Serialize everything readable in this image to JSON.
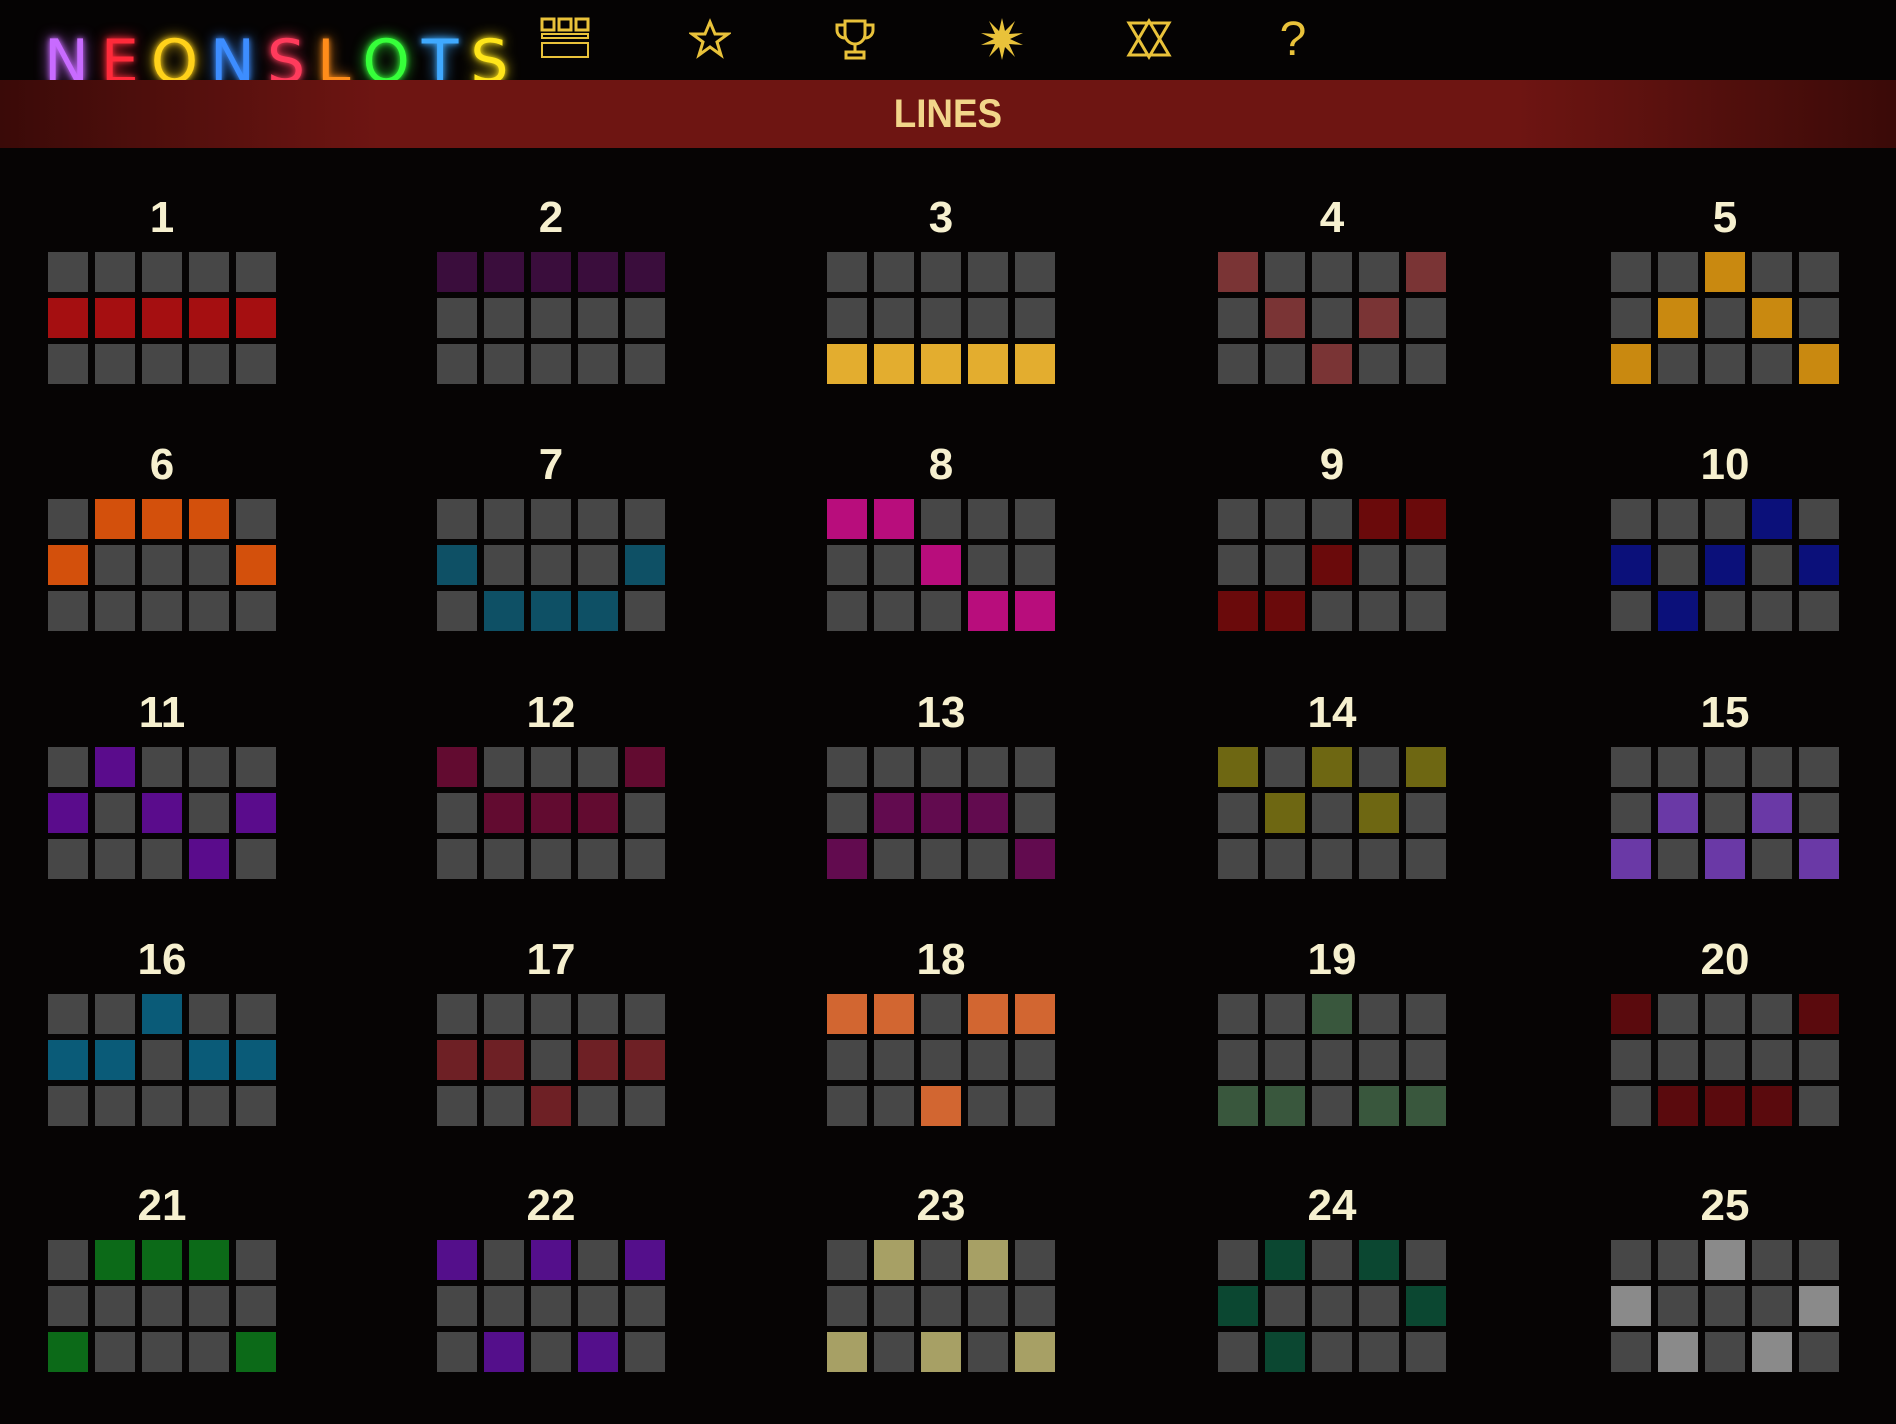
{
  "logo": {
    "letters": [
      {
        "ch": "N",
        "color": "#c86bff"
      },
      {
        "ch": "E",
        "color": "#ff2a3a"
      },
      {
        "ch": "O",
        "color": "#ffd21a"
      },
      {
        "ch": "N",
        "color": "#3d8dff"
      },
      {
        "ch": "S",
        "color": "#ff3b5c"
      },
      {
        "ch": "L",
        "color": "#ff8c1a"
      },
      {
        "ch": "O",
        "color": "#36ff3a"
      },
      {
        "ch": "T",
        "color": "#3fa9ff"
      },
      {
        "ch": "S",
        "color": "#ffe51a"
      }
    ]
  },
  "nav": [
    {
      "name": "paytable-icon"
    },
    {
      "name": "star-icon"
    },
    {
      "name": "trophy-icon"
    },
    {
      "name": "burst-icon"
    },
    {
      "name": "scatter-icon"
    },
    {
      "name": "help-icon",
      "label": "?"
    }
  ],
  "header": {
    "title": "LINES"
  },
  "cell_off_color": "#474747",
  "lines": [
    {
      "n": "1",
      "color": "#a50f11",
      "rows": [
        [
          0,
          0,
          0,
          0,
          0
        ],
        [
          1,
          1,
          1,
          1,
          1
        ],
        [
          0,
          0,
          0,
          0,
          0
        ]
      ]
    },
    {
      "n": "2",
      "color": "#3a0d3c",
      "rows": [
        [
          1,
          1,
          1,
          1,
          1
        ],
        [
          0,
          0,
          0,
          0,
          0
        ],
        [
          0,
          0,
          0,
          0,
          0
        ]
      ]
    },
    {
      "n": "3",
      "color": "#e3ad2f",
      "rows": [
        [
          0,
          0,
          0,
          0,
          0
        ],
        [
          0,
          0,
          0,
          0,
          0
        ],
        [
          1,
          1,
          1,
          1,
          1
        ]
      ]
    },
    {
      "n": "4",
      "color": "#7a3435",
      "rows": [
        [
          1,
          0,
          0,
          0,
          1
        ],
        [
          0,
          1,
          0,
          1,
          0
        ],
        [
          0,
          0,
          1,
          0,
          0
        ]
      ]
    },
    {
      "n": "5",
      "color": "#c98910",
      "rows": [
        [
          0,
          0,
          1,
          0,
          0
        ],
        [
          0,
          1,
          0,
          1,
          0
        ],
        [
          1,
          0,
          0,
          0,
          1
        ]
      ]
    },
    {
      "n": "6",
      "color": "#d3500c",
      "rows": [
        [
          0,
          1,
          1,
          1,
          0
        ],
        [
          1,
          0,
          0,
          0,
          1
        ],
        [
          0,
          0,
          0,
          0,
          0
        ]
      ]
    },
    {
      "n": "7",
      "color": "#0e5065",
      "rows": [
        [
          0,
          0,
          0,
          0,
          0
        ],
        [
          1,
          0,
          0,
          0,
          1
        ],
        [
          0,
          1,
          1,
          1,
          0
        ]
      ]
    },
    {
      "n": "8",
      "color": "#b80d7c",
      "rows": [
        [
          1,
          1,
          0,
          0,
          0
        ],
        [
          0,
          0,
          1,
          0,
          0
        ],
        [
          0,
          0,
          0,
          1,
          1
        ]
      ]
    },
    {
      "n": "9",
      "color": "#6a0a0b",
      "rows": [
        [
          0,
          0,
          0,
          1,
          1
        ],
        [
          0,
          0,
          1,
          0,
          0
        ],
        [
          1,
          1,
          0,
          0,
          0
        ]
      ]
    },
    {
      "n": "10",
      "color": "#0b107a",
      "rows": [
        [
          0,
          0,
          0,
          1,
          0
        ],
        [
          1,
          0,
          1,
          0,
          1
        ],
        [
          0,
          1,
          0,
          0,
          0
        ]
      ]
    },
    {
      "n": "11",
      "color": "#5a0c8c",
      "rows": [
        [
          0,
          1,
          0,
          0,
          0
        ],
        [
          1,
          0,
          1,
          0,
          1
        ],
        [
          0,
          0,
          0,
          1,
          0
        ]
      ]
    },
    {
      "n": "12",
      "color": "#620b30",
      "rows": [
        [
          1,
          0,
          0,
          0,
          1
        ],
        [
          0,
          1,
          1,
          1,
          0
        ],
        [
          0,
          0,
          0,
          0,
          0
        ]
      ]
    },
    {
      "n": "13",
      "color": "#620b4f",
      "rows": [
        [
          0,
          0,
          0,
          0,
          0
        ],
        [
          0,
          1,
          1,
          1,
          0
        ],
        [
          1,
          0,
          0,
          0,
          1
        ]
      ]
    },
    {
      "n": "14",
      "color": "#6e6712",
      "rows": [
        [
          1,
          0,
          1,
          0,
          1
        ],
        [
          0,
          1,
          0,
          1,
          0
        ],
        [
          0,
          0,
          0,
          0,
          0
        ]
      ]
    },
    {
      "n": "15",
      "color": "#6a39a6",
      "rows": [
        [
          0,
          0,
          0,
          0,
          0
        ],
        [
          0,
          1,
          0,
          1,
          0
        ],
        [
          1,
          0,
          1,
          0,
          1
        ]
      ]
    },
    {
      "n": "16",
      "color": "#0a5b78",
      "rows": [
        [
          0,
          0,
          1,
          0,
          0
        ],
        [
          1,
          1,
          0,
          1,
          1
        ],
        [
          0,
          0,
          0,
          0,
          0
        ]
      ]
    },
    {
      "n": "17",
      "color": "#6e2025",
      "rows": [
        [
          0,
          0,
          0,
          0,
          0
        ],
        [
          1,
          1,
          0,
          1,
          1
        ],
        [
          0,
          0,
          1,
          0,
          0
        ]
      ]
    },
    {
      "n": "18",
      "color": "#d26631",
      "rows": [
        [
          1,
          1,
          0,
          1,
          1
        ],
        [
          0,
          0,
          0,
          0,
          0
        ],
        [
          0,
          0,
          1,
          0,
          0
        ]
      ]
    },
    {
      "n": "19",
      "color": "#39573d",
      "rows": [
        [
          0,
          0,
          1,
          0,
          0
        ],
        [
          0,
          0,
          0,
          0,
          0
        ],
        [
          1,
          1,
          0,
          1,
          1
        ]
      ]
    },
    {
      "n": "20",
      "color": "#5a0a0d",
      "rows": [
        [
          1,
          0,
          0,
          0,
          1
        ],
        [
          0,
          0,
          0,
          0,
          0
        ],
        [
          0,
          1,
          1,
          1,
          0
        ]
      ]
    },
    {
      "n": "21",
      "color": "#0c6a18",
      "rows": [
        [
          0,
          1,
          1,
          1,
          0
        ],
        [
          0,
          0,
          0,
          0,
          0
        ],
        [
          1,
          0,
          0,
          0,
          1
        ]
      ]
    },
    {
      "n": "22",
      "color": "#540f8b",
      "rows": [
        [
          1,
          0,
          1,
          0,
          1
        ],
        [
          0,
          0,
          0,
          0,
          0
        ],
        [
          0,
          1,
          0,
          1,
          0
        ]
      ]
    },
    {
      "n": "23",
      "color": "#a7a065",
      "rows": [
        [
          0,
          1,
          0,
          1,
          0
        ],
        [
          0,
          0,
          0,
          0,
          0
        ],
        [
          1,
          0,
          1,
          0,
          1
        ]
      ]
    },
    {
      "n": "24",
      "color": "#0b4731",
      "rows": [
        [
          0,
          1,
          0,
          1,
          0
        ],
        [
          1,
          0,
          0,
          0,
          1
        ],
        [
          0,
          1,
          0,
          0,
          0
        ]
      ]
    },
    {
      "n": "25",
      "color": "#8a8a8a",
      "rows": [
        [
          0,
          0,
          1,
          0,
          0
        ],
        [
          1,
          0,
          0,
          0,
          1
        ],
        [
          0,
          1,
          0,
          1,
          0
        ]
      ]
    }
  ]
}
